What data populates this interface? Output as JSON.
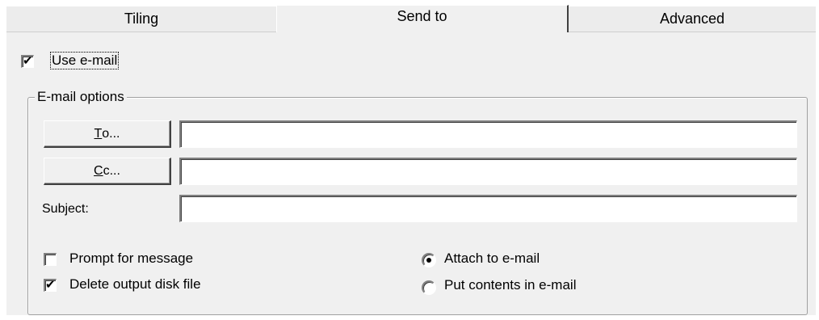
{
  "tabs": [
    {
      "label": "Tiling",
      "active": false
    },
    {
      "label": "Send to",
      "active": true
    },
    {
      "label": "Advanced",
      "active": false
    }
  ],
  "use_email": {
    "label": "Use e-mail",
    "checked": true
  },
  "email_options": {
    "title": "E-mail options",
    "to_button": {
      "label": "To...",
      "underline": "T",
      "rest": "o..."
    },
    "cc_button": {
      "label": "Cc...",
      "underline": "C",
      "rest": "c..."
    },
    "to_value": "",
    "cc_value": "",
    "subject_label": "Subject:",
    "subject_value": "",
    "prompt_for_message": {
      "label": "Prompt for message",
      "checked": false
    },
    "delete_output_disk_file": {
      "label": "Delete output disk file",
      "checked": true
    },
    "attach_to_email": {
      "label": "Attach to e-mail",
      "selected": true
    },
    "put_contents_in_email": {
      "label": "Put contents in e-mail",
      "selected": false
    }
  },
  "check_glyph": "✔"
}
